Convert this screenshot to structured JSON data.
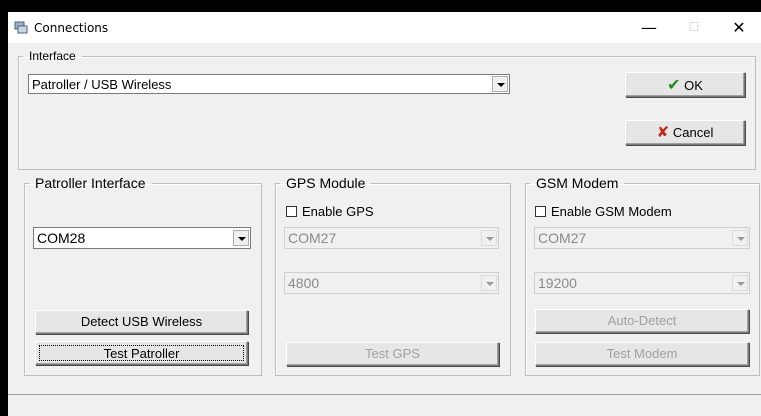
{
  "window": {
    "title": "Connections",
    "minimize_glyph": "—",
    "maximize_glyph": "☐",
    "close_glyph": "✕"
  },
  "interface": {
    "legend": "Interface",
    "selected": "Patroller / USB Wireless",
    "ok_label": "OK",
    "cancel_label": "Cancel",
    "ok_icon_glyph": "✔",
    "cancel_icon_glyph": "✘",
    "colors": {
      "ok_icon": "#1f8a1f",
      "cancel_icon": "#c0281e"
    }
  },
  "patroller": {
    "legend": "Patroller Interface",
    "port": "COM28",
    "detect_label": "Detect USB Wireless",
    "test_label": "Test Patroller"
  },
  "gps": {
    "legend": "GPS Module",
    "enable_label": "Enable GPS",
    "enabled": false,
    "port": "COM27",
    "baud": "4800",
    "test_label": "Test GPS"
  },
  "gsm": {
    "legend": "GSM Modem",
    "enable_label": "Enable GSM Modem",
    "enabled": false,
    "port": "COM27",
    "baud": "19200",
    "autodetect_label": "Auto-Detect",
    "test_label": "Test Modem"
  }
}
